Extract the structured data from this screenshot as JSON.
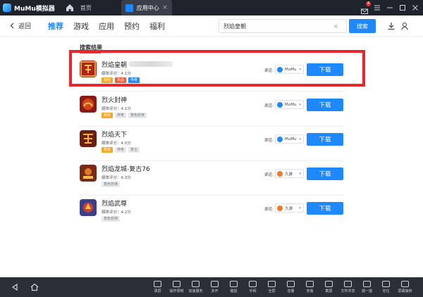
{
  "titlebar": {
    "app_title": "MuMu模拟器",
    "home_tab_label": "首页",
    "active_tab_label": "应用中心",
    "close_glyph": "×",
    "mail_badge": "4"
  },
  "nav": {
    "back_label": "返回",
    "tabs": [
      "推荐",
      "游戏",
      "应用",
      "预约",
      "福利"
    ],
    "search_value": "烈焰皇朝",
    "clear_glyph": "×",
    "search_button": "搜索"
  },
  "results": {
    "title": "搜索结果",
    "source_label": "渠道:",
    "download_label": "下载",
    "items": [
      {
        "name": "烈焰皇朝",
        "rating": "媒体评分：4.1分",
        "source": "MuMu",
        "tags": [
          "角色",
          "热血",
          "传奇"
        ],
        "icon_color": "#b0231a"
      },
      {
        "name": "烈火封神",
        "rating": "媒体评分：4.1分",
        "source": "MuMu",
        "tags": [
          "角色",
          "传奇",
          "角色扮演"
        ],
        "icon_color": "#8a1a12"
      },
      {
        "name": "烈焰天下",
        "rating": "媒体评分：4.0分",
        "source": "MuMu",
        "tags": [
          "角色",
          "传奇",
          "复古"
        ],
        "icon_color": "#6b1d10"
      },
      {
        "name": "烈焰龙城-复古76",
        "rating": "媒体评分：4.3分",
        "source": "九游",
        "tags": [
          "角色扮演"
        ],
        "icon_color": "#7a2a14"
      },
      {
        "name": "烈焰武尊",
        "rating": "媒体评分：4.2分",
        "source": "九游",
        "tags": [
          "角色扮演"
        ],
        "icon_color": "#3a3f8a"
      }
    ]
  },
  "toolbar": {
    "tools": [
      "录屏",
      "操作录制",
      "加速服务",
      "多开",
      "键鼠",
      "手柄",
      "全屏",
      "音量",
      "安装",
      "截屏",
      "文件共享",
      "摇一摇",
      "定位",
      "屏幕旋转"
    ]
  },
  "colors": {
    "accent": "#1e88ff",
    "highlight": "#e8262c",
    "tag_orange": "#f5a623",
    "tag_red": "#f05a3c",
    "tag_blue": "#1e88ff"
  }
}
